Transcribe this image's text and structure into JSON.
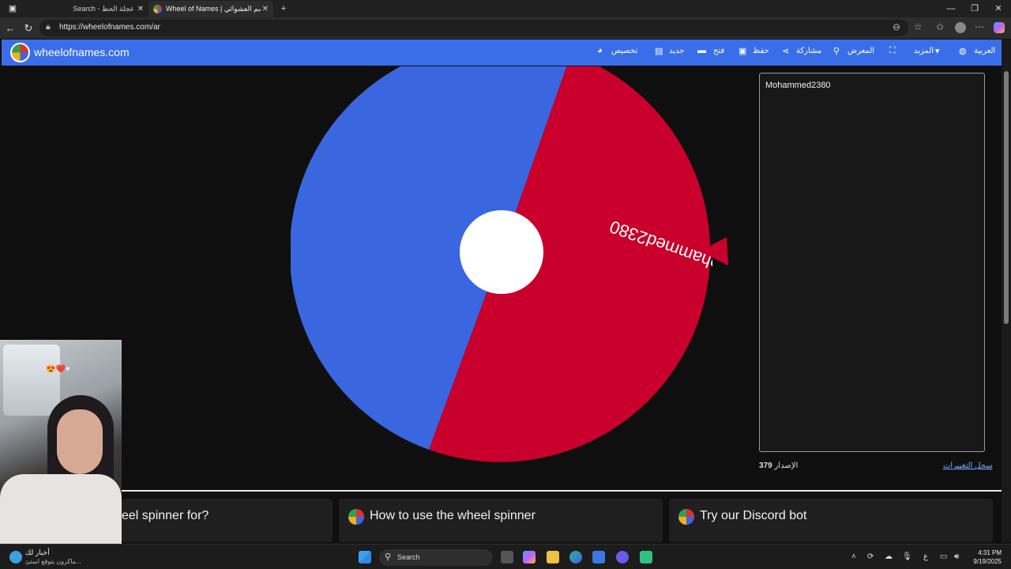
{
  "browser": {
    "tabs": [
      {
        "label": "Search - عجلة الحظ",
        "active": false
      },
      {
        "label": "Wheel of Names | الاسم العشوائي",
        "active": true
      }
    ],
    "url": "https://wheelofnames.com/ar"
  },
  "site": {
    "name": "wheelofnames.com",
    "menu": {
      "customize": "تخصيص",
      "new": "جديد",
      "open": "فتح",
      "save": "حفظ",
      "share": "مشاركة",
      "gallery": "المعرض",
      "more": "المزيد",
      "language": "العربية"
    }
  },
  "wheel": {
    "segments": [
      {
        "label": "Mohammed2380",
        "color": "#3a66e0"
      },
      {
        "label": "",
        "color": "#c8002b"
      }
    ],
    "pointer_color": "#c8002b"
  },
  "entries": {
    "items": [
      "Mohammed2380"
    ],
    "version_label": "الإصدار",
    "version_number": "379",
    "changelog_link": "سجل التغييرات"
  },
  "cards": [
    {
      "title": "eel spinner for?"
    },
    {
      "title": "How to use the wheel spinner"
    },
    {
      "title": "Try our Discord bot"
    }
  ],
  "taskbar": {
    "news_title": "أخبار لك",
    "news_sub": "ماكرون يتوقع استئ...",
    "search_placeholder": "Search",
    "time": "4:31 PM",
    "date": "9/19/2025",
    "lang": "ع"
  },
  "colors": {
    "site_bar": "#3a6ee8",
    "wheel_blue": "#3a66e0",
    "wheel_red": "#c8002b"
  }
}
